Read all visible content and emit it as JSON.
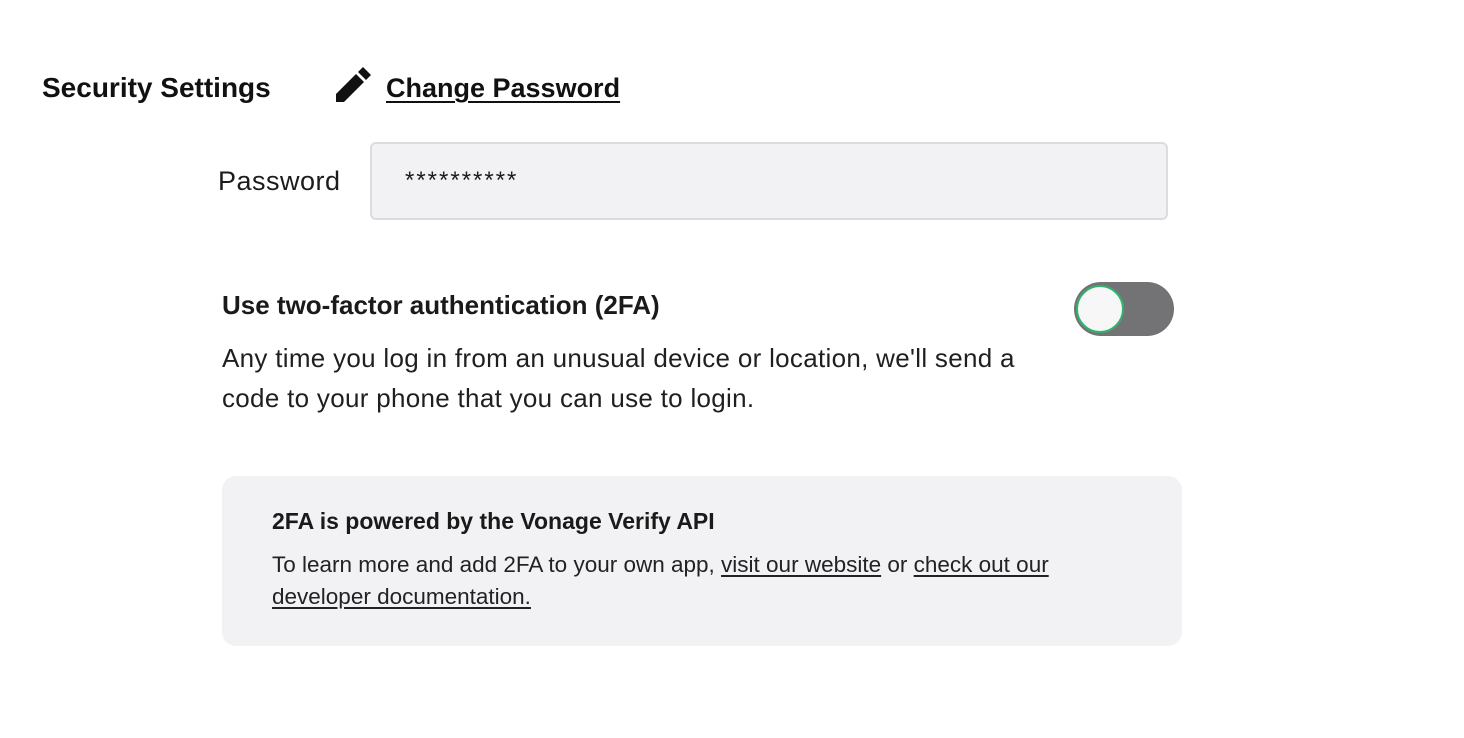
{
  "header": {
    "title": "Security Settings",
    "edit_icon": "pencil-icon",
    "change_password_label": "Change Password"
  },
  "password": {
    "label": "Password",
    "value": "**********"
  },
  "two_factor": {
    "title": "Use two-factor authentication (2FA)",
    "description": "Any time you log in from an unusual device or location, we'll send a code to your phone that you can use to login.",
    "toggle_state": "off",
    "toggle_track_color": "#737375",
    "toggle_knob_border_color": "#2fb36e"
  },
  "info": {
    "title": "2FA is powered by the Vonage Verify API",
    "text_before": "To learn more and add 2FA to your own app, ",
    "link_website": "visit our website",
    "text_between": " or ",
    "link_docs": "check out our developer documentation."
  }
}
